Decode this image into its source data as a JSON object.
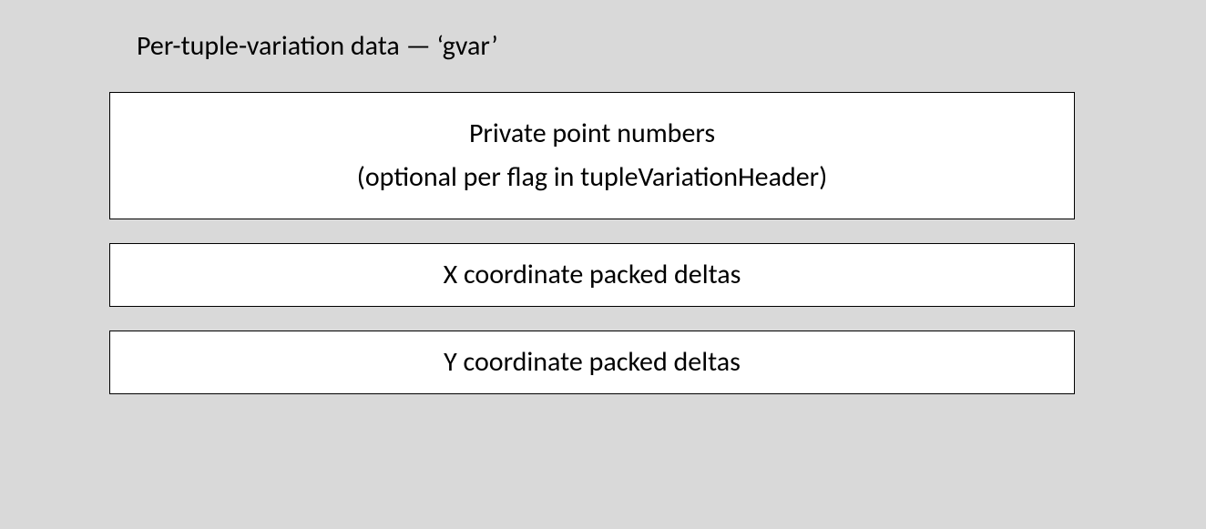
{
  "title": "Per-tuple-variation data — ‘gvar’",
  "box1": {
    "line1": "Private point numbers",
    "line2": "(optional per flag in tupleVariationHeader)"
  },
  "box2": {
    "text": "X coordinate packed deltas"
  },
  "box3": {
    "text": "Y coordinate packed deltas"
  }
}
